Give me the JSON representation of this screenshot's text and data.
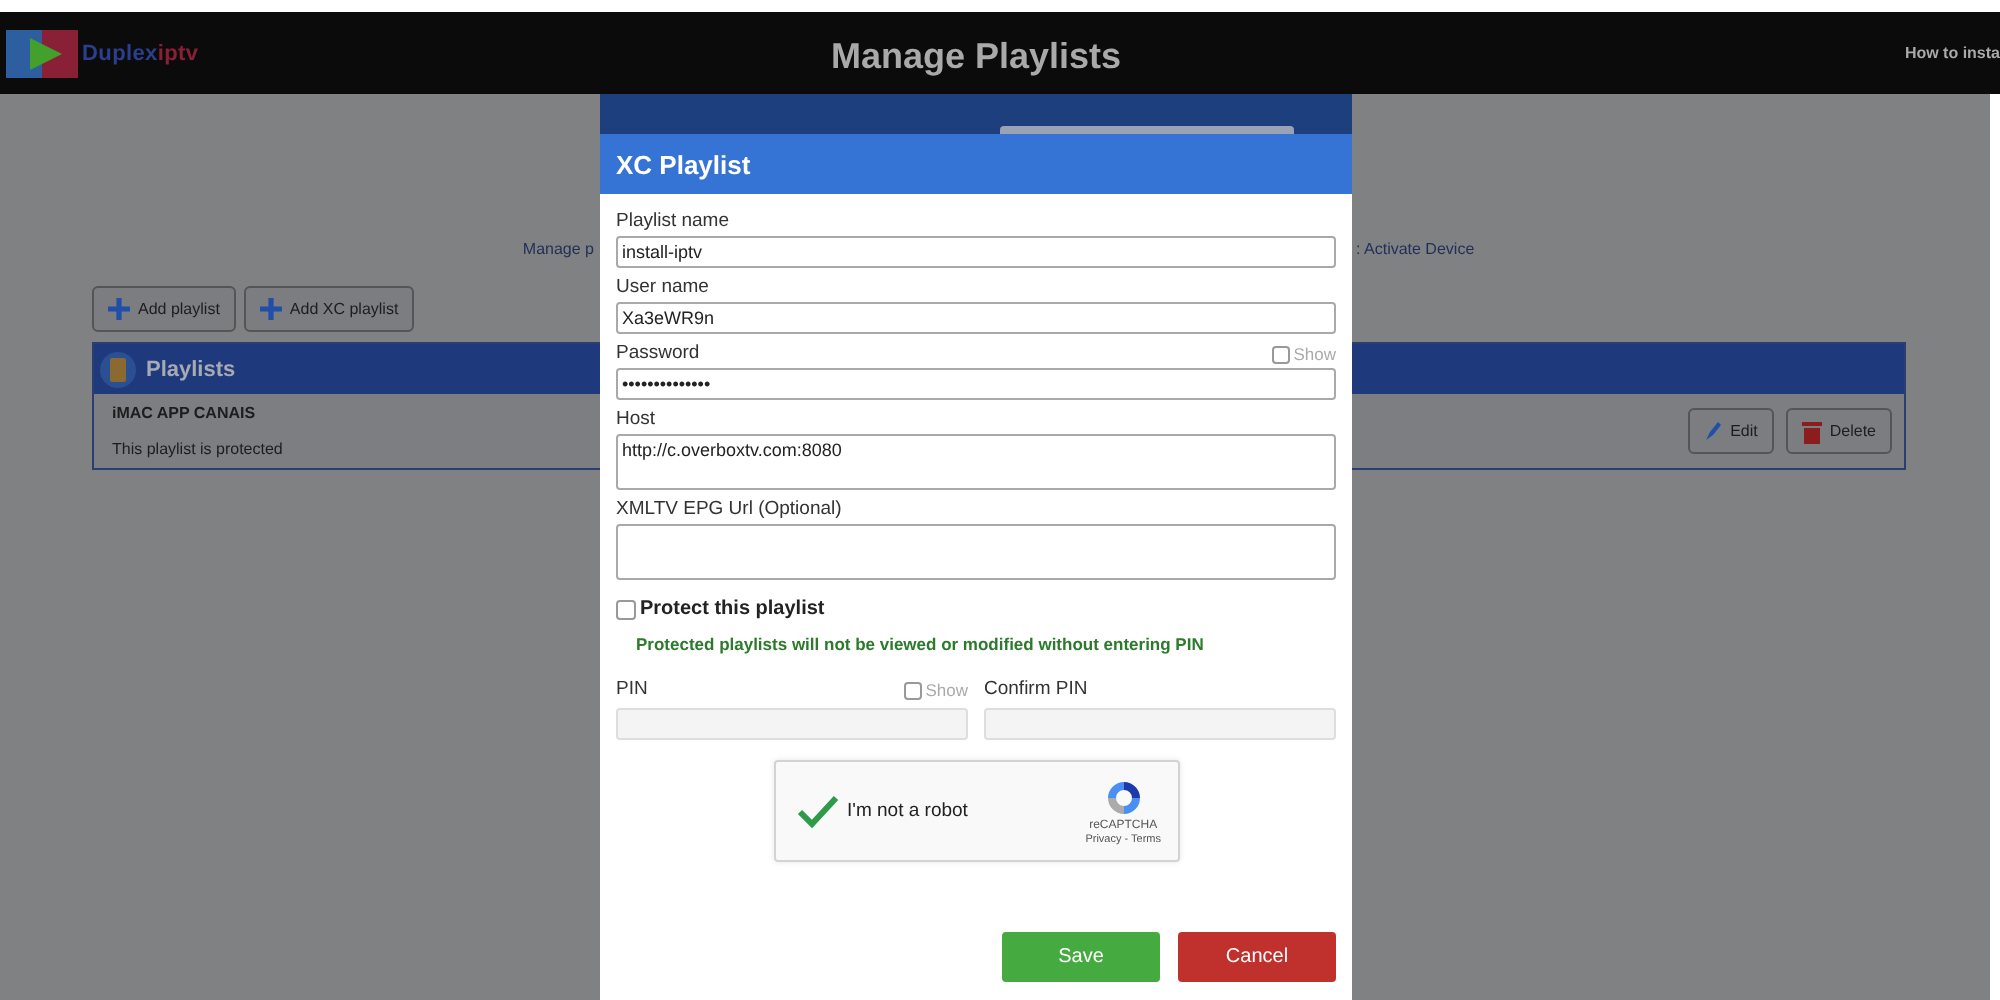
{
  "header": {
    "logo_parts": [
      "Duplex",
      "iptv"
    ],
    "title": "Manage Playlists",
    "link": "How to insta"
  },
  "page": {
    "nav_left": "Manage p",
    "nav_right": ": Activate Device",
    "buttons": [
      "Add playlist",
      "Add XC playlist"
    ],
    "panel_title": "Playlists",
    "playlists": [
      {
        "name": "iMAC APP CANAIS",
        "note": "This playlist is protected",
        "actions": [
          {
            "kind": "edit",
            "label": "Edit"
          },
          {
            "kind": "delete",
            "label": "Delete"
          }
        ]
      }
    ]
  },
  "modal": {
    "title": "XC Playlist",
    "fields": [
      {
        "kind": "text",
        "label": "Playlist name",
        "value": "install-iptv"
      },
      {
        "kind": "text",
        "label": "User name",
        "value": "Xa3eWR9n"
      },
      {
        "kind": "text",
        "label": "Password",
        "value": "••••••••••••••",
        "show": {
          "label": "Show",
          "checked": false
        }
      },
      {
        "kind": "textarea",
        "label": "Host",
        "value": "http://c.overboxtv.com:8080"
      },
      {
        "kind": "textarea",
        "label": "XMLTV EPG Url (Optional)"
      }
    ],
    "protect": {
      "label": "Protect this playlist",
      "checked": false
    },
    "protect_note": "Protected playlists will not be viewed or modified without entering PIN",
    "pin_fields": [
      {
        "label": "PIN",
        "disabled": true,
        "show": {
          "label": "Show",
          "checked": false
        }
      },
      {
        "label": "Confirm PIN",
        "disabled": true
      }
    ],
    "captcha": {
      "label": "I'm not a robot",
      "checked": true,
      "brand": "reCAPTCHA",
      "links": "Privacy - Terms"
    },
    "buttons": [
      {
        "kind": "save",
        "label": "Save"
      },
      {
        "kind": "cancel",
        "label": "Cancel"
      }
    ]
  }
}
